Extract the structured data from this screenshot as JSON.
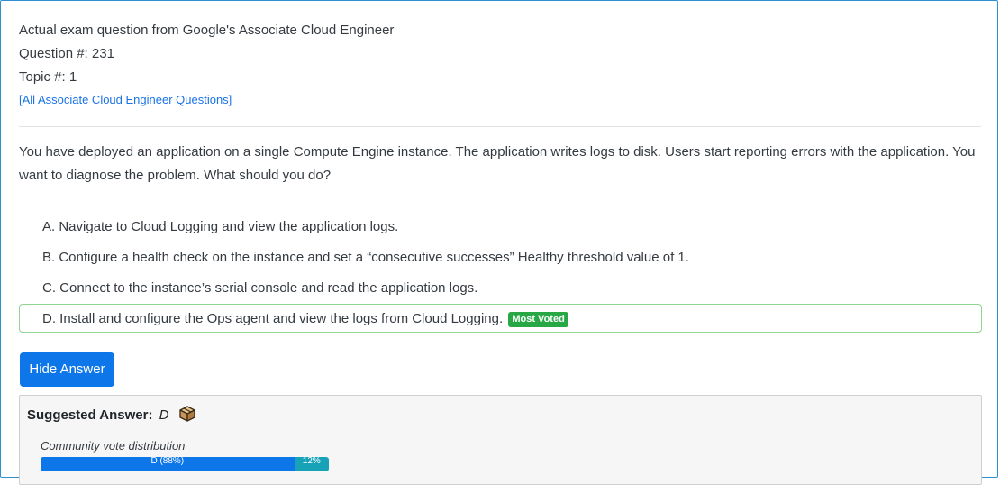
{
  "header": {
    "title": "Actual exam question from Google's Associate Cloud Engineer",
    "question_number": "Question #: 231",
    "topic": "Topic #: 1",
    "all_questions_link": "[All Associate Cloud Engineer Questions]"
  },
  "question": {
    "text": "You have deployed an application on a single Compute Engine instance. The application writes logs to disk. Users start reporting errors with the application. You want to diagnose the problem. What should you do?"
  },
  "choices": [
    {
      "text": "A. Navigate to Cloud Logging and view the application logs."
    },
    {
      "text": "B. Configure a health check on the instance and set a “consecutive successes” Healthy threshold value of 1."
    },
    {
      "text": "C. Connect to the instance’s serial console and read the application logs."
    },
    {
      "text": "D. Install and configure the Ops agent and view the logs from Cloud Logging.",
      "badge": "Most Voted"
    }
  ],
  "hide_answer_button": "Hide Answer",
  "answer": {
    "label": "Suggested Answer:",
    "value": "D",
    "icon": "box-icon",
    "vote_title": "Community vote distribution",
    "votes": [
      {
        "label": "D (88%)",
        "percent": 88,
        "color": "#0d76e8"
      },
      {
        "label": "12%",
        "percent": 12,
        "color": "#17a2b8"
      }
    ]
  }
}
